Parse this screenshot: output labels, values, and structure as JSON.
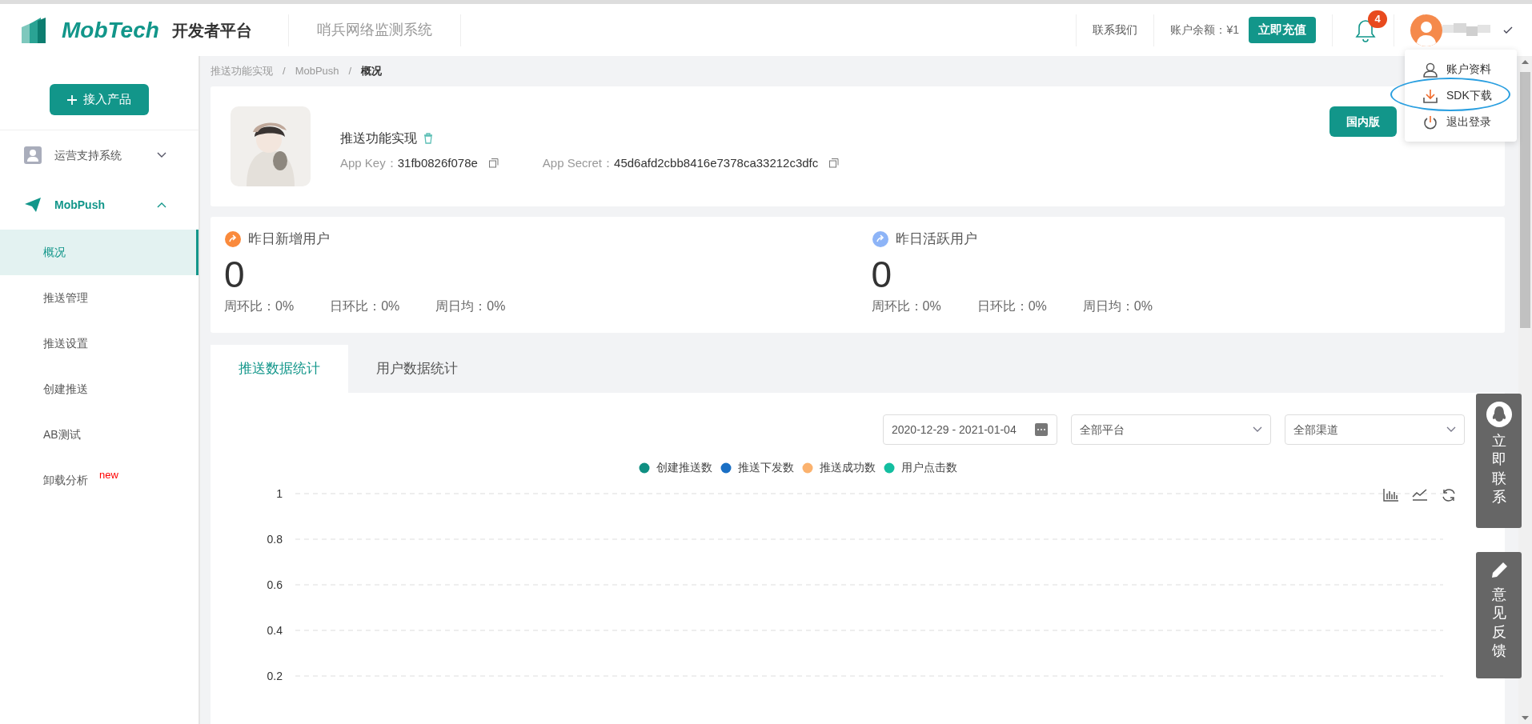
{
  "header": {
    "logo_text": "MobTech",
    "platform": "开发者平台",
    "system_name": "哨兵网络监测系统",
    "contact": "联系我们",
    "balance": "账户余额：¥1",
    "recharge": "立即充值",
    "notification_count": "4"
  },
  "user_menu": {
    "items": [
      {
        "label": "账户资料",
        "kind": "user",
        "highlighted": false
      },
      {
        "label": "SDK下载",
        "kind": "download",
        "highlighted": true
      },
      {
        "label": "退出登录",
        "kind": "power",
        "highlighted": false
      }
    ]
  },
  "sidebar": {
    "add_button": "接入产品",
    "sections": [
      {
        "label": "运营支持系统",
        "kind": "user",
        "expanded": false
      },
      {
        "label": "MobPush",
        "kind": "plane",
        "expanded": true,
        "children": [
          {
            "label": "概况",
            "selected": true
          },
          {
            "label": "推送管理",
            "selected": false
          },
          {
            "label": "推送设置",
            "selected": false
          },
          {
            "label": "创建推送",
            "selected": false
          },
          {
            "label": "AB测试",
            "selected": false
          },
          {
            "label": "卸载分析",
            "selected": false,
            "badge": "new"
          }
        ]
      }
    ]
  },
  "breadcrumb": {
    "separator": "/",
    "items": [
      "推送功能实现",
      "MobPush",
      "概况"
    ]
  },
  "app": {
    "name": "推送功能实现",
    "key_label": "App Key：",
    "key": "31fb0826f078e",
    "secret_label": "App Secret：",
    "secret": "45d6afd2cbb8416e7378ca33212c3dfc",
    "region": "国内版"
  },
  "stats": [
    {
      "title": "昨日新增用户",
      "color": "#fa8a3c",
      "value": "0",
      "metrics": [
        "周环比：0%",
        "日环比：0%",
        "周日均：0%"
      ]
    },
    {
      "title": "昨日活跃用户",
      "color": "#8db4f7",
      "value": "0",
      "metrics": [
        "周环比：0%",
        "日环比：0%",
        "周日均：0%"
      ]
    }
  ],
  "tabs": [
    {
      "label": "推送数据统计",
      "selected": true
    },
    {
      "label": "用户数据统计",
      "selected": false
    }
  ],
  "filters": {
    "date_range": "2020-12-29 - 2021-01-04",
    "platform": "全部平台",
    "channel": "全部渠道"
  },
  "chart_data": {
    "type": "line",
    "grid": true,
    "ylim": [
      0.2,
      1
    ],
    "yticks": [
      0.2,
      0.4,
      0.6,
      0.8,
      1
    ],
    "series": [
      {
        "name": "创建推送数",
        "color": "#0f8f82"
      },
      {
        "name": "推送下发数",
        "color": "#1a6fc4"
      },
      {
        "name": "推送成功数",
        "color": "#fbb26e"
      },
      {
        "name": "用户点击数",
        "color": "#13bea0"
      }
    ]
  },
  "float_buttons": [
    {
      "label": "立即联系",
      "kind": "chat"
    },
    {
      "label": "意见反馈",
      "kind": "feedback"
    }
  ]
}
